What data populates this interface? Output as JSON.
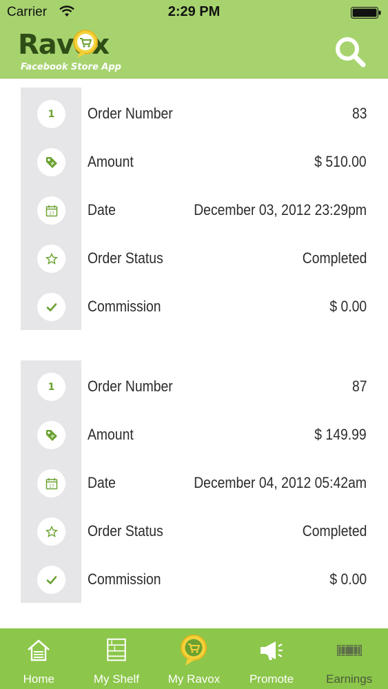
{
  "status_bar": {
    "carrier": "Carrier",
    "time": "2:29 PM"
  },
  "header": {
    "brand": "Ravox",
    "tagline": "Facebook Store App",
    "search_icon": "search-icon"
  },
  "orders": [
    {
      "rows": [
        {
          "icon": "number-one-icon",
          "icon_text": "1",
          "label": "Order Number",
          "value": "83"
        },
        {
          "icon": "price-tag-icon",
          "label": "Amount",
          "value": "$ 510.00"
        },
        {
          "icon": "calendar-icon",
          "label": "Date",
          "value": "December 03, 2012 23:29pm"
        },
        {
          "icon": "star-icon",
          "label": "Order Status",
          "value": "Completed"
        },
        {
          "icon": "checkmark-icon",
          "label": "Commission",
          "value": "$ 0.00"
        }
      ]
    },
    {
      "rows": [
        {
          "icon": "number-one-icon",
          "icon_text": "1",
          "label": "Order Number",
          "value": "87"
        },
        {
          "icon": "price-tag-icon",
          "label": "Amount",
          "value": "$ 149.99"
        },
        {
          "icon": "calendar-icon",
          "label": "Date",
          "value": "December 04, 2012 05:42am"
        },
        {
          "icon": "star-icon",
          "label": "Order Status",
          "value": "Completed"
        },
        {
          "icon": "checkmark-icon",
          "label": "Commission",
          "value": "$ 0.00"
        }
      ]
    }
  ],
  "tabs": [
    {
      "label": "Home",
      "icon": "home-icon"
    },
    {
      "label": "My Shelf",
      "icon": "shelf-icon"
    },
    {
      "label": "My Ravox",
      "icon": "ravox-cart-icon",
      "active": true
    },
    {
      "label": "Promote",
      "icon": "megaphone-icon"
    },
    {
      "label": "Earnings",
      "icon": "money-icon"
    }
  ],
  "colors": {
    "header_green": "#a7d36f",
    "tab_green": "#8cc64a",
    "icon_green": "#6aa130",
    "gutter_gray": "#e6e6e8"
  }
}
